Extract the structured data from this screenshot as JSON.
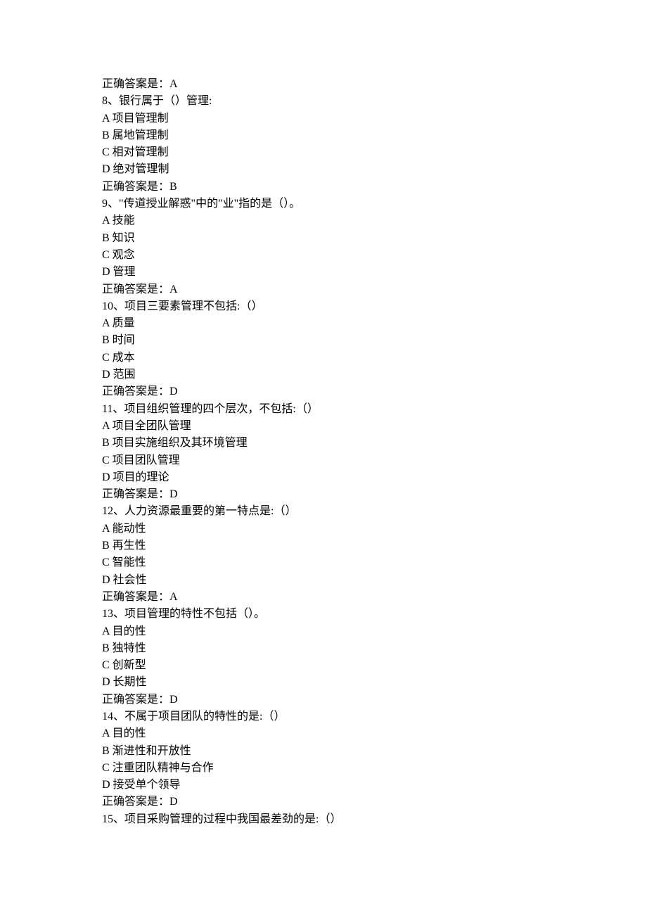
{
  "lines": [
    "正确答案是：A",
    "8、银行属于（）管理:",
    "A 项目管理制",
    "B 属地管理制",
    "C 相对管理制",
    "D 绝对管理制",
    "正确答案是：B",
    "9、\"传道授业解惑\"中的\"业\"指的是（）。",
    "A 技能",
    "B 知识",
    "C 观念",
    "D 管理",
    "正确答案是：A",
    "10、项目三要素管理不包括:（）",
    "A 质量",
    "B 时间",
    "C 成本",
    "D 范围",
    "正确答案是：D",
    "11、项目组织管理的四个层次，不包括:（）",
    "A 项目全团队管理",
    "B 项目实施组织及其环境管理",
    "C 项目团队管理",
    "D 项目的理论",
    "正确答案是：D",
    "12、人力资源最重要的第一特点是:（）",
    "A 能动性",
    "B 再生性",
    "C 智能性",
    "D 社会性",
    "正确答案是：A",
    "13、项目管理的特性不包括（）。",
    "A 目的性",
    "B 独特性",
    "C 创新型",
    "D 长期性",
    "正确答案是：D",
    "14、不属于项目团队的特性的是:（）",
    "A 目的性",
    "B 渐进性和开放性",
    "C 注重团队精神与合作",
    "D 接受单个领导",
    "正确答案是：D",
    "15、项目采购管理的过程中我国最差劲的是:（）"
  ]
}
